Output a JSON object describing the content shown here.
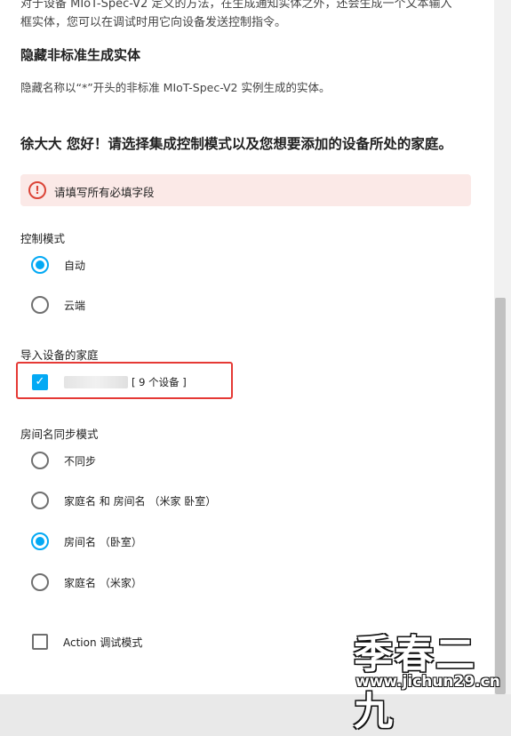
{
  "intro": {
    "line1": "对于设备 MIoT-Spec-V2 定义的方法，在生成通知实体之外，还会生成一个文本输入",
    "line2": "框实体，您可以在调试时用它向设备发送控制指令。"
  },
  "hide_section": {
    "title": "隐藏非标准生成实体",
    "description": "隐藏名称以“*”开头的非标准 MIoT-Spec-V2 实例生成的实体。"
  },
  "greeting": "徐大大 您好！请选择集成控制模式以及您想要添加的设备所处的家庭。",
  "error": {
    "text": "请填写所有必填字段",
    "icon": "alert-circle-icon",
    "color": "#db4437"
  },
  "control_mode": {
    "label": "控制模式",
    "options": [
      {
        "label": "自动",
        "checked": true
      },
      {
        "label": "云端",
        "checked": false
      }
    ]
  },
  "home_import": {
    "label": "导入设备的家庭",
    "homes": [
      {
        "count_label": "[ 9 个设备 ]",
        "checked": true
      }
    ]
  },
  "room_sync": {
    "label": "房间名同步模式",
    "options": [
      {
        "label": "不同步",
        "checked": false
      },
      {
        "label": "家庭名 和 房间名 （米家 卧室）",
        "checked": false
      },
      {
        "label": "房间名 （卧室）",
        "checked": true
      },
      {
        "label": "家庭名 （米家）",
        "checked": false
      }
    ]
  },
  "action_debug": {
    "label": "Action 调试模式",
    "checked": false
  },
  "watermark": {
    "line1": "季春二九",
    "line2": "www.jichun29.cn"
  },
  "colors": {
    "accent": "#03a9f4",
    "highlight": "#e53935",
    "error_bg": "#fbe9e7"
  }
}
